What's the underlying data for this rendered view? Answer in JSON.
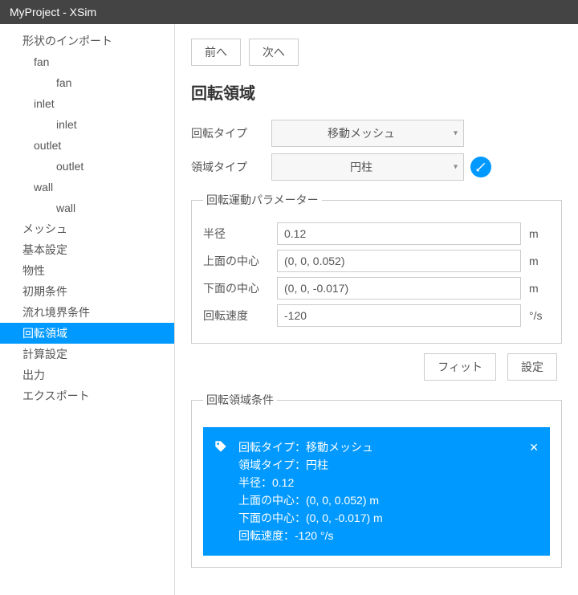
{
  "titlebar": "MyProject - XSim",
  "sidebar": {
    "items": [
      {
        "label": "形状のインポート",
        "level": 0
      },
      {
        "label": "fan",
        "level": 1
      },
      {
        "label": "fan",
        "level": 2
      },
      {
        "label": "inlet",
        "level": 1
      },
      {
        "label": "inlet",
        "level": 2
      },
      {
        "label": "outlet",
        "level": 1
      },
      {
        "label": "outlet",
        "level": 2
      },
      {
        "label": "wall",
        "level": 1
      },
      {
        "label": "wall",
        "level": 2
      },
      {
        "label": "メッシュ",
        "level": 0
      },
      {
        "label": "基本設定",
        "level": 0
      },
      {
        "label": "物性",
        "level": 0
      },
      {
        "label": "初期条件",
        "level": 0
      },
      {
        "label": "流れ境界条件",
        "level": 0
      },
      {
        "label": "回転領域",
        "level": 0,
        "active": true
      },
      {
        "label": "計算設定",
        "level": 0
      },
      {
        "label": "出力",
        "level": 0
      },
      {
        "label": "エクスポート",
        "level": 0
      }
    ]
  },
  "nav": {
    "prev": "前へ",
    "next": "次へ"
  },
  "heading": "回転領域",
  "form": {
    "rotationType": {
      "label": "回転タイプ",
      "value": "移動メッシュ"
    },
    "regionType": {
      "label": "領域タイプ",
      "value": "円柱"
    }
  },
  "paramsLegend": "回転運動パラメーター",
  "params": {
    "radius": {
      "label": "半径",
      "value": "0.12",
      "unit": "m"
    },
    "top": {
      "label": "上面の中心",
      "value": "(0, 0, 0.052)",
      "unit": "m"
    },
    "bottom": {
      "label": "下面の中心",
      "value": "(0, 0, -0.017)",
      "unit": "m"
    },
    "speed": {
      "label": "回転速度",
      "value": "-120",
      "unit": "°/s"
    }
  },
  "actions": {
    "fit": "フィット",
    "set": "設定"
  },
  "summaryLegend": "回転領域条件",
  "summary": {
    "l1": "回転タイプ：移動メッシュ",
    "l2": "領域タイプ：円柱",
    "l3": "半径：0.12",
    "l4": "上面の中心：(0, 0, 0.052) m",
    "l5": "下面の中心：(0, 0, -0.017) m",
    "l6": "回転速度：-120 °/s"
  }
}
